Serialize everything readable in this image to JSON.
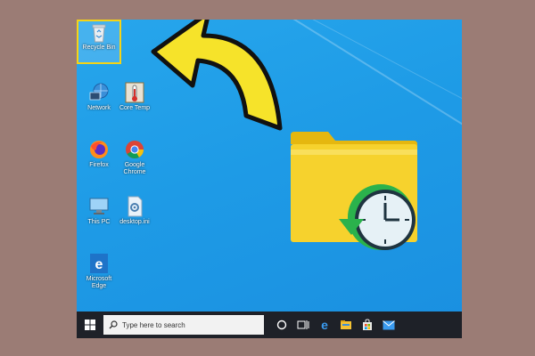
{
  "desktop": {
    "icons": [
      {
        "label": "Recycle Bin",
        "icon": "recycle-bin-icon"
      },
      {
        "label": "Network",
        "icon": "network-icon"
      },
      {
        "label": "Core Temp",
        "icon": "core-temp-icon"
      },
      {
        "label": "Firefox",
        "icon": "firefox-icon"
      },
      {
        "label": "Google Chrome",
        "icon": "chrome-icon"
      },
      {
        "label": "This PC",
        "icon": "this-pc-icon"
      },
      {
        "label": "desktop.ini",
        "icon": "settings-file-icon"
      },
      {
        "label": "Microsoft Edge",
        "icon": "edge-icon"
      }
    ]
  },
  "taskbar": {
    "search_placeholder": "Type here to search",
    "items": [
      "cortana-icon",
      "task-view-icon",
      "edge-icon",
      "file-explorer-icon",
      "store-icon",
      "mail-icon"
    ]
  },
  "overlay": {
    "arrow_color": "#f6e32a",
    "folder_color": "#f6d22d",
    "restore_arrow_color": "#2bb24c"
  }
}
